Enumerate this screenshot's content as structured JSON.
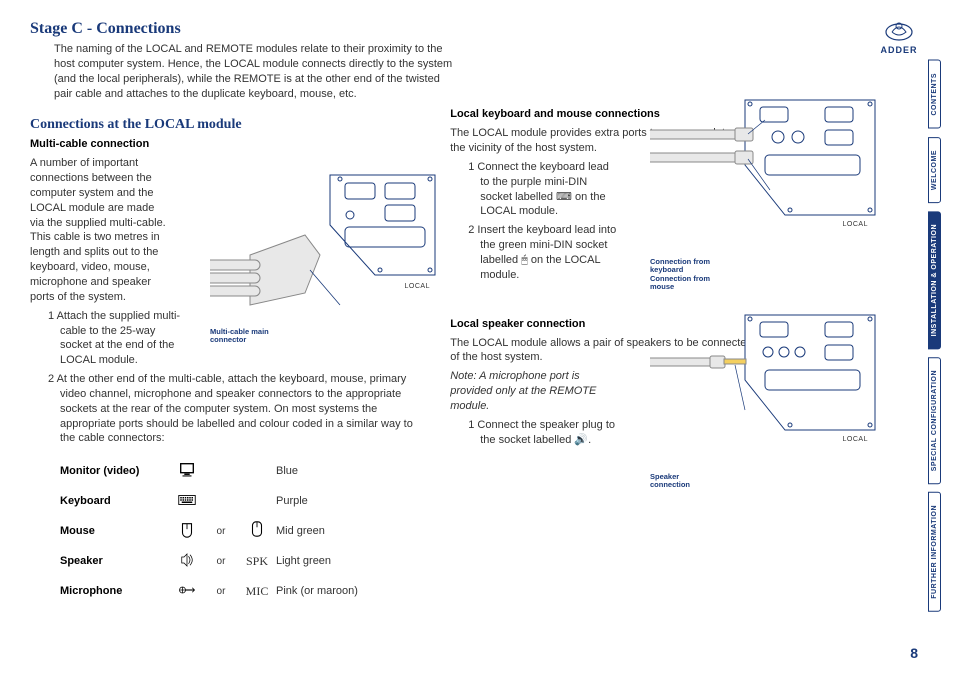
{
  "heading": "Stage C - Connections",
  "intro": "The naming of the LOCAL and REMOTE modules relate to their proximity to the host computer system. Hence, the LOCAL module connects directly to the system (and the local peripherals), while the REMOTE is at the other end of the twisted pair cable and attaches to the duplicate keyboard, mouse, etc.",
  "subheading": "Connections at the LOCAL module",
  "multi_cable_title": "Multi-cable connection",
  "multi_cable_body": "A number of important connections between the computer system and the LOCAL module are made via the supplied multi-cable. This cable is two metres in length and splits out to the keyboard, video, mouse, microphone and speaker ports of the system.",
  "step1": "1  Attach the supplied multi-cable to the 25-way socket at the end of the LOCAL module.",
  "step2": "2  At the other end of the multi-cable, attach the keyboard, mouse, primary video channel, microphone and speaker connectors to the appropriate sockets at the rear of the computer system. On most systems the appropriate ports should be labelled and colour coded in a similar way to the cable connectors:",
  "table": {
    "rows": [
      {
        "label": "Monitor (video)",
        "or": "",
        "alt": "",
        "color": "Blue"
      },
      {
        "label": "Keyboard",
        "or": "",
        "alt": "",
        "color": "Purple"
      },
      {
        "label": "Mouse",
        "or": "or",
        "alt": "",
        "color": "Mid green"
      },
      {
        "label": "Speaker",
        "or": "or",
        "alt": "SPK",
        "color": "Light green"
      },
      {
        "label": "Microphone",
        "or": "or",
        "alt": "MIC",
        "color": "Pink (or maroon)"
      }
    ]
  },
  "kb_mouse_title": "Local keyboard and mouse connections",
  "kb_mouse_body": "The LOCAL module provides extra ports to accommodate a keyboard and mouse in the vicinity of the host system.",
  "km_step1": "1  Connect the keyboard lead to the purple mini-DIN socket labelled ⌨ on the LOCAL module.",
  "km_step2": "2  Insert the keyboard lead into the green mini-DIN socket labelled 🖱 on the LOCAL module.",
  "speaker_title": "Local speaker connection",
  "speaker_body": "The LOCAL module allows a pair of speakers to be connected and used in the vicinity of the host system.",
  "speaker_note": "Note: A microphone port is provided only at the REMOTE module.",
  "sp_step1": "1  Connect the speaker plug to the socket labelled 🔊.",
  "diag_labels": {
    "local": "LOCAL",
    "multi_cable": "Multi-cable main connector",
    "kb_conn": "Connection from keyboard",
    "mouse_conn": "Connection from mouse",
    "spk_conn": "Speaker connection"
  },
  "logo_text": "ADDER",
  "tabs": [
    "CONTENTS",
    "WELCOME",
    "INSTALLATION & OPERATION",
    "SPECIAL CONFIGURATION",
    "FURTHER INFORMATION"
  ],
  "active_tab": 2,
  "page_number": "8"
}
